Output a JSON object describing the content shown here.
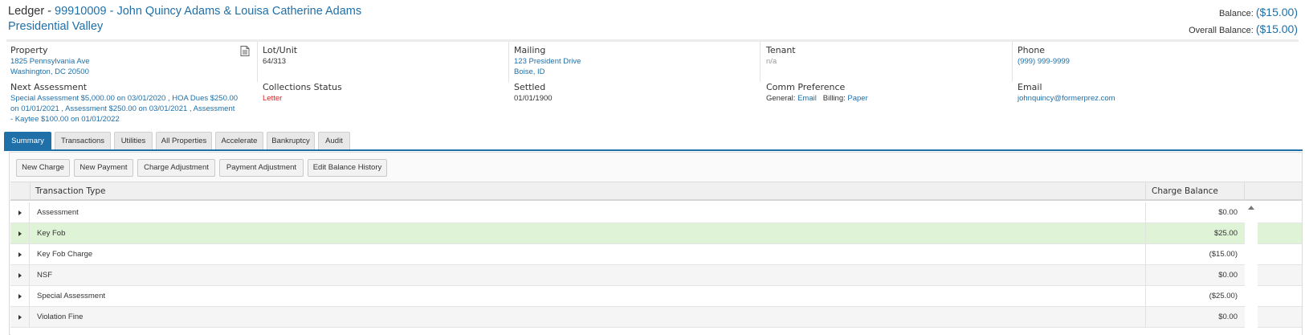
{
  "header": {
    "prefix": "Ledger - ",
    "account": "99910009 - John Quincy Adams & Louisa Catherine Adams",
    "community": "Presidential Valley",
    "balance_label": "Balance:",
    "balance": "($15.00)",
    "overall_label": "Overall Balance:",
    "overall": "($15.00)"
  },
  "info": {
    "property_label": "Property",
    "property_line1": "1825 Pennsylvania Ave",
    "property_line2": "Washington, DC 20500",
    "lot_label": "Lot/Unit",
    "lot": "64/313",
    "mailing_label": "Mailing",
    "mailing_line1": "123 President Drive",
    "mailing_line2": "Boise, ID",
    "tenant_label": "Tenant",
    "tenant": "n/a",
    "phone_label": "Phone",
    "phone": "(999) 999-9999",
    "next_label": "Next Assessment",
    "next_line1": "Special Assessment $5,000.00 on 03/01/2020 , HOA Dues $250.00",
    "next_line2": "on 01/01/2021 , Assessment $250.00 on 03/01/2021 , Assessment",
    "next_line3": "- Kaytee $100.00 on 01/01/2022",
    "collections_label": "Collections Status",
    "collections": "Letter",
    "settled_label": "Settled",
    "settled": "01/01/1900",
    "comm_label": "Comm Preference",
    "comm_general_label": "General:",
    "comm_general": "Email",
    "comm_billing_label": "Billing:",
    "comm_billing": "Paper",
    "email_label": "Email",
    "email": "johnquincy@formerprez.com"
  },
  "tabs": [
    "Summary",
    "Transactions",
    "Utilities",
    "All Properties",
    "Accelerate",
    "Bankruptcy",
    "Audit"
  ],
  "toolbar": [
    "New Charge",
    "New Payment",
    "Charge Adjustment",
    "Payment Adjustment",
    "Edit Balance History"
  ],
  "grid": {
    "col_type": "Transaction Type",
    "col_balance": "Charge Balance",
    "rows": [
      {
        "type": "Assessment",
        "balance": "$0.00"
      },
      {
        "type": "Key Fob",
        "balance": "$25.00"
      },
      {
        "type": "Key Fob Charge",
        "balance": "($15.00)"
      },
      {
        "type": "NSF",
        "balance": "$0.00"
      },
      {
        "type": "Special Assessment",
        "balance": "($25.00)"
      },
      {
        "type": "Violation Fine",
        "balance": "$0.00"
      }
    ]
  },
  "colors": {
    "accent": "#1f6fa8",
    "highlight_row": "#dff3d6",
    "status_red": "#e02020"
  },
  "icons": {
    "document": "document-icon",
    "expand": "expand-arrow-icon",
    "scroll": "scroll-up-icon"
  }
}
